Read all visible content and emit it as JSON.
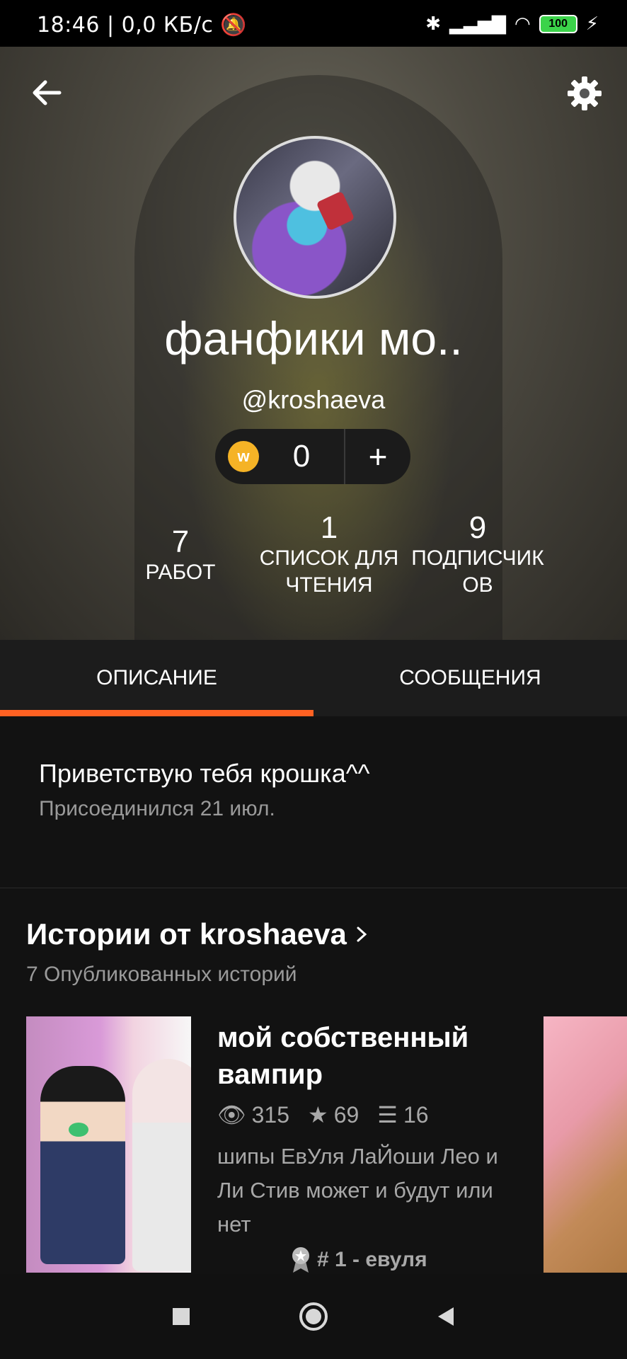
{
  "status_bar": {
    "time_text": "18:46 | 0,0 КБ/с",
    "battery": "100"
  },
  "header": {
    "name": "фанфики мо..",
    "handle": "@kroshaeva",
    "coins": "0",
    "coin_add": "+",
    "coin_symbol": "w",
    "stats": [
      {
        "value": "7",
        "label": "РАБОТ"
      },
      {
        "value": "1",
        "label": "СПИСОК ДЛЯ ЧТЕНИЯ"
      },
      {
        "value": "9",
        "label": "ПОДПИСЧИК ОВ"
      }
    ]
  },
  "tabs": [
    {
      "label": "ОПИСАНИЕ",
      "active": true
    },
    {
      "label": "СООБЩЕНИЯ",
      "active": false
    }
  ],
  "about": {
    "text": "Приветствую тебя крошка^^",
    "joined": "Присоединился 21 июл."
  },
  "stories": {
    "title": "Истории от kroshaeva",
    "subtitle": "7 Опубликованных историй",
    "items": [
      {
        "title": "мой собственный вампир",
        "views": "315",
        "votes": "69",
        "parts": "16",
        "tags": "шипы ЕвУля ЛаЙоши Лео и Ли Стив может и будут или нет",
        "rank": "# 1 - евуля"
      }
    ]
  },
  "colors": {
    "accent": "#ff6122",
    "coin": "#f5b326"
  }
}
